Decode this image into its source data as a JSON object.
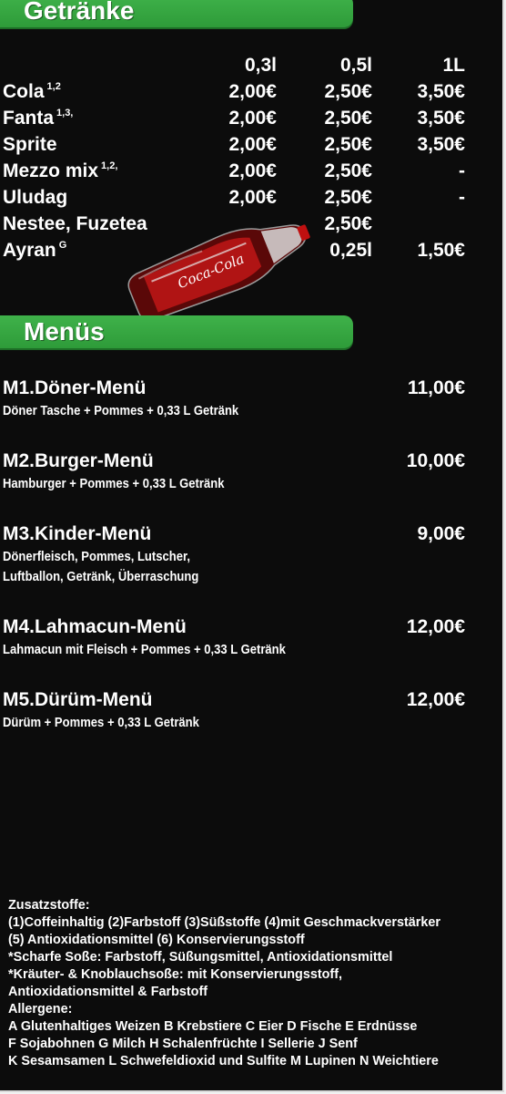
{
  "drinks": {
    "section_title": "Getränke",
    "columns": [
      "0,3l",
      "0,5l",
      "1L"
    ],
    "rows": [
      {
        "name": "Cola",
        "sup": "1,2",
        "p1": "2,00€",
        "p2": "2,50€",
        "p3": "3,50€"
      },
      {
        "name": "Fanta",
        "sup": "1,3,",
        "p1": "2,00€",
        "p2": "2,50€",
        "p3": "3,50€"
      },
      {
        "name": "Sprite",
        "sup": "",
        "p1": "2,00€",
        "p2": "2,50€",
        "p3": "3,50€"
      },
      {
        "name": "Mezzo mix",
        "sup": "1,2,",
        "p1": "2,00€",
        "p2": "2,50€",
        "p3": "-"
      },
      {
        "name": "Uludag",
        "sup": "",
        "p1": "2,00€",
        "p2": "2,50€",
        "p3": "-"
      },
      {
        "name": "Nestee, Fuzetea",
        "sup": "",
        "p1": "",
        "p2": "2,50€",
        "p3": ""
      },
      {
        "name": "Ayran",
        "sup": "G",
        "p1": "",
        "p2": "0,25l",
        "p3": "1,50€"
      }
    ]
  },
  "bottle": {
    "brand": "Coca-Cola"
  },
  "menus": {
    "section_title": "Menüs",
    "items": [
      {
        "title": "M1.Döner-Menü",
        "price": "11,00€",
        "desc": [
          "Döner Tasche + Pommes + 0,33 L Getränk"
        ]
      },
      {
        "title": "M2.Burger-Menü",
        "price": "10,00€",
        "desc": [
          "Hamburger + Pommes + 0,33 L Getränk"
        ]
      },
      {
        "title": "M3.Kinder-Menü",
        "price": "9,00€",
        "desc": [
          "Dönerfleisch, Pommes, Lutscher,",
          "Luftballon, Getränk, Überraschung"
        ]
      },
      {
        "title": "M4.Lahmacun-Menü",
        "price": "12,00€",
        "desc": [
          "Lahmacun mit Fleisch + Pommes + 0,33 L Getränk"
        ]
      },
      {
        "title": "M5.Dürüm-Menü",
        "price": "12,00€",
        "desc": [
          "Dürüm + Pommes + 0,33 L Getränk"
        ]
      }
    ]
  },
  "notes": {
    "lines": [
      "Zusatzstoffe:",
      "(1)Coffeinhaltig (2)Farbstoff (3)Süßstoffe (4)mit Geschmackverstärker",
      "(5) Antioxidationsmittel (6) Konservierungsstoff",
      "*Scharfe Soße: Farbstoff, Süßungsmittel, Antioxidationsmittel",
      "*Kräuter- & Knoblauchsoße: mit Konservierungsstoff,",
      "Antioxidationsmittel & Farbstoff",
      "Allergene:",
      "A Glutenhaltiges Weizen B Krebstiere C Eier D Fische E Erdnüsse",
      "F Sojabohnen G Milch H Schalenfrüchte I Sellerie J Senf",
      "K Sesamsamen L Schwefeldioxid und Sulfite M Lupinen N Weichtiere"
    ]
  },
  "colors": {
    "background": "#0c0c0c",
    "accent_green": "#3fb24a",
    "text": "#ffffff"
  }
}
